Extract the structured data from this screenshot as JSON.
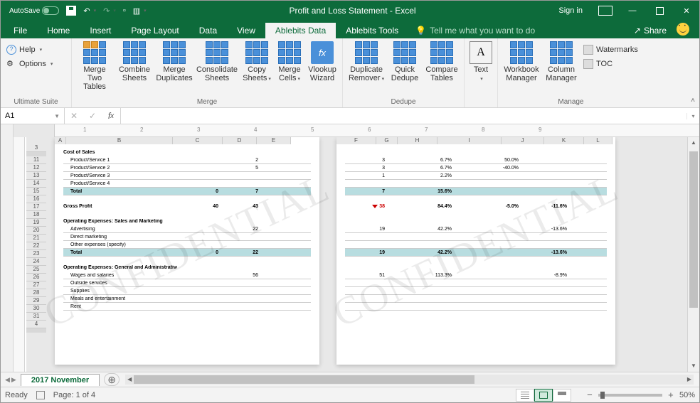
{
  "titlebar": {
    "autosave": "AutoSave",
    "title": "Profit and Loss Statement  -  Excel",
    "signin": "Sign in"
  },
  "tabs": {
    "file": "File",
    "home": "Home",
    "insert": "Insert",
    "pagelayout": "Page Layout",
    "data": "Data",
    "view": "View",
    "ablebits_data": "Ablebits Data",
    "ablebits_tools": "Ablebits Tools",
    "tellme": "Tell me what you want to do",
    "share": "Share"
  },
  "ribbon": {
    "group1": {
      "help": "Help",
      "options": "Options",
      "label": "Ultimate Suite"
    },
    "merge": {
      "merge_two": "Merge Two Tables",
      "combine": "Combine Sheets",
      "merge_dup": "Merge Duplicates",
      "consolidate": "Consolidate Sheets",
      "copy": "Copy Sheets",
      "merge_cells": "Merge Cells",
      "vlookup": "Vlookup Wizard",
      "label": "Merge"
    },
    "dedupe": {
      "dup_remover": "Duplicate Remover",
      "quick": "Quick Dedupe",
      "compare": "Compare Tables",
      "label": "Dedupe"
    },
    "text": {
      "text": "Text"
    },
    "manage": {
      "workbook": "Workbook Manager",
      "column": "Column Manager",
      "watermarks": "Watermarks",
      "toc": "TOC",
      "label": "Manage"
    }
  },
  "formula": {
    "namebox": "A1"
  },
  "sheet": {
    "col_letters_p1": [
      "A",
      "B",
      "C",
      "D",
      "E"
    ],
    "col_letters_p2": [
      "F",
      "G",
      "H",
      "I",
      "J",
      "K",
      "L"
    ],
    "row_nums": [
      3,
      11,
      12,
      13,
      14,
      15,
      16,
      17,
      18,
      19,
      20,
      21,
      22,
      23,
      24,
      25,
      26,
      27,
      28,
      29,
      30,
      31,
      4
    ],
    "watermark": "CONFIDENTIAL",
    "sections": {
      "cost_header": "Cost of Sales",
      "products": [
        "Product/Service 1",
        "Product/Service 2",
        "Product/Service 3",
        "Product/Service 4"
      ],
      "total": "Total",
      "gross": "Gross Profit",
      "opex_sales": "Operating Expenses: Sales and Marketing",
      "opex_items": [
        "Advertising",
        "Direct marketing",
        "Other expenses (specify)"
      ],
      "opex_ga": "Operating Expenses: General and Administrative",
      "ga_items": [
        "Wages and salaries",
        "Outside services",
        "Supplies",
        "Meals and entertainment",
        "Rent"
      ]
    },
    "p1_vals": {
      "cost_d": [
        "",
        "",
        "",
        ""
      ],
      "cost_e": [
        "2",
        "5",
        "",
        ""
      ],
      "cost_total": [
        "0",
        "7"
      ],
      "gross": [
        "40",
        "43"
      ],
      "opex_d": [
        "",
        "",
        ""
      ],
      "opex_e": [
        "22",
        "",
        ""
      ],
      "opex_total": [
        "0",
        "22"
      ],
      "ga_e": [
        "56",
        "",
        "",
        "",
        ""
      ]
    },
    "p2_vals": {
      "cost": [
        {
          "f": "3",
          "h": "6.7%",
          "j": "50.0%"
        },
        {
          "f": "3",
          "h": "6.7%",
          "j": "-40.0%"
        },
        {
          "f": "1",
          "h": "2.2%",
          "j": ""
        },
        {
          "f": "",
          "h": "",
          "j": ""
        }
      ],
      "cost_total": {
        "f": "7",
        "h": "15.6%",
        "j": ""
      },
      "gross": {
        "f": "38",
        "h": "84.4%",
        "j": "-5.0%",
        "k": "-11.6%"
      },
      "opex": [
        {
          "f": "19",
          "h": "42.2%",
          "j": "",
          "k": "-13.6%"
        },
        {
          "f": "",
          "h": "",
          "j": "",
          "k": ""
        },
        {
          "f": "",
          "h": "",
          "j": "",
          "k": ""
        }
      ],
      "opex_total": {
        "f": "19",
        "h": "42.2%",
        "j": "",
        "k": "-13.6%"
      },
      "ga": [
        {
          "f": "51",
          "h": "113.3%",
          "j": "",
          "k": "-8.9%"
        },
        {
          "f": "",
          "h": "",
          "j": "",
          "k": ""
        },
        {
          "f": "",
          "h": "",
          "j": "",
          "k": ""
        },
        {
          "f": "",
          "h": "",
          "j": "",
          "k": ""
        },
        {
          "f": "",
          "h": "",
          "j": "",
          "k": ""
        }
      ]
    }
  },
  "tabs_bottom": {
    "sheet1": "2017 November"
  },
  "status": {
    "ready": "Ready",
    "page": "Page: 1 of 4",
    "zoom": "50%"
  }
}
